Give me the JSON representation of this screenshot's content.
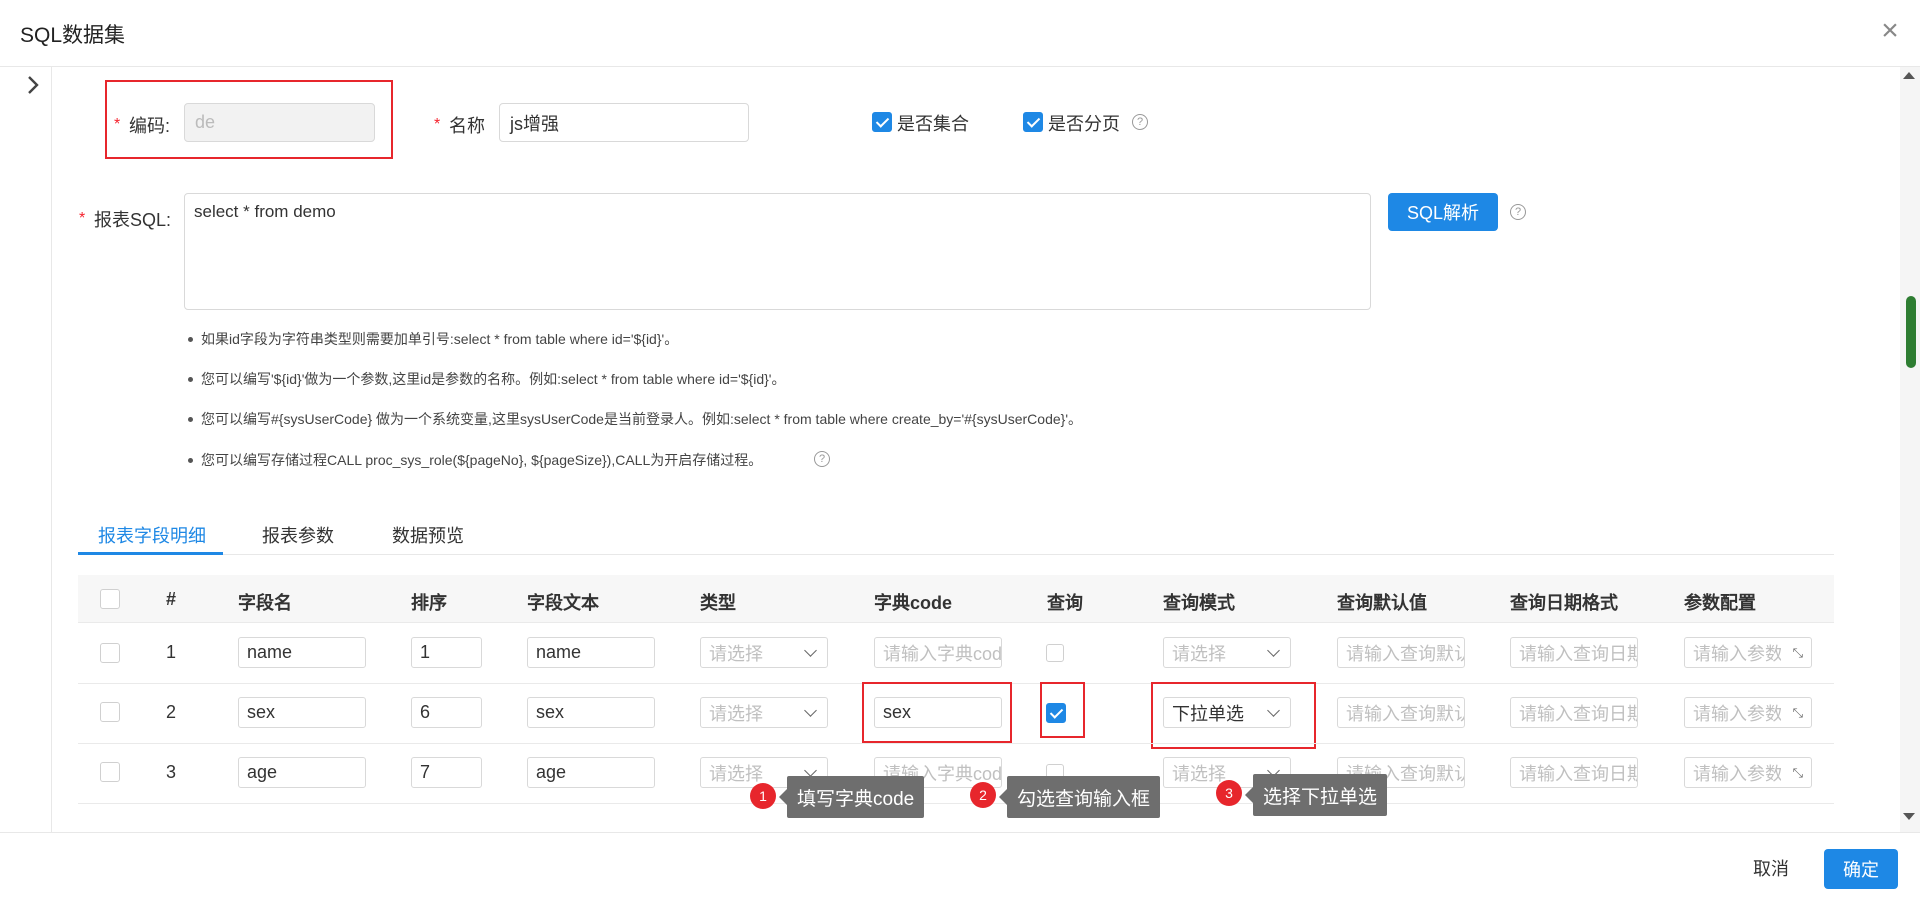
{
  "header": {
    "title": "SQL数据集"
  },
  "form": {
    "code_label": "编码:",
    "code_value": "de",
    "name_label": "名称",
    "name_value": "js增强",
    "is_collection_label": "是否集合",
    "is_collection_checked": true,
    "is_paged_label": "是否分页",
    "is_paged_checked": true,
    "sql_label": "报表SQL:",
    "sql_value": "select * from demo",
    "parse_button": "SQL解析",
    "tips": [
      "如果id字段为字符串类型则需要加单引号:select * from table where id='${id}'。",
      "您可以编写'${id}'做为一个参数,这里id是参数的名称。例如:select * from table where id='${id}'。",
      "您可以编写#{sysUserCode} 做为一个系统变量,这里sysUserCode是当前登录人。例如:select * from table where create_by='#{sysUserCode}'。",
      "您可以编写存储过程CALL proc_sys_role(${pageNo}, ${pageSize}),CALL为开启存储过程。"
    ]
  },
  "tabs": [
    {
      "label": "报表字段明细",
      "active": true
    },
    {
      "label": "报表参数",
      "active": false
    },
    {
      "label": "数据预览",
      "active": false
    }
  ],
  "table": {
    "headers": [
      "#",
      "字段名",
      "排序",
      "字段文本",
      "类型",
      "字典code",
      "查询",
      "查询模式",
      "查询默认值",
      "查询日期格式",
      "参数配置"
    ],
    "placeholders": {
      "select": "请选择",
      "dict_code": "请输入字典code",
      "default_value": "请输入查询默认值",
      "date_format": "请输入查询日期格式",
      "param_config": "请输入参数配置"
    },
    "rows": [
      {
        "index": "1",
        "field": "name",
        "order": "1",
        "text": "name",
        "dict_code": "",
        "query": false,
        "query_mode": ""
      },
      {
        "index": "2",
        "field": "sex",
        "order": "6",
        "text": "sex",
        "dict_code": "sex",
        "query": true,
        "query_mode": "下拉单选"
      },
      {
        "index": "3",
        "field": "age",
        "order": "7",
        "text": "age",
        "dict_code": "",
        "query": false,
        "query_mode": ""
      }
    ]
  },
  "callouts": [
    {
      "num": "1",
      "text": "填写字典code"
    },
    {
      "num": "2",
      "text": "勾选查询输入框"
    },
    {
      "num": "3",
      "text": "选择下拉单选"
    }
  ],
  "footer": {
    "cancel": "取消",
    "ok": "确定"
  },
  "colors": {
    "primary": "#1e88e5",
    "highlight": "#e7262c"
  }
}
